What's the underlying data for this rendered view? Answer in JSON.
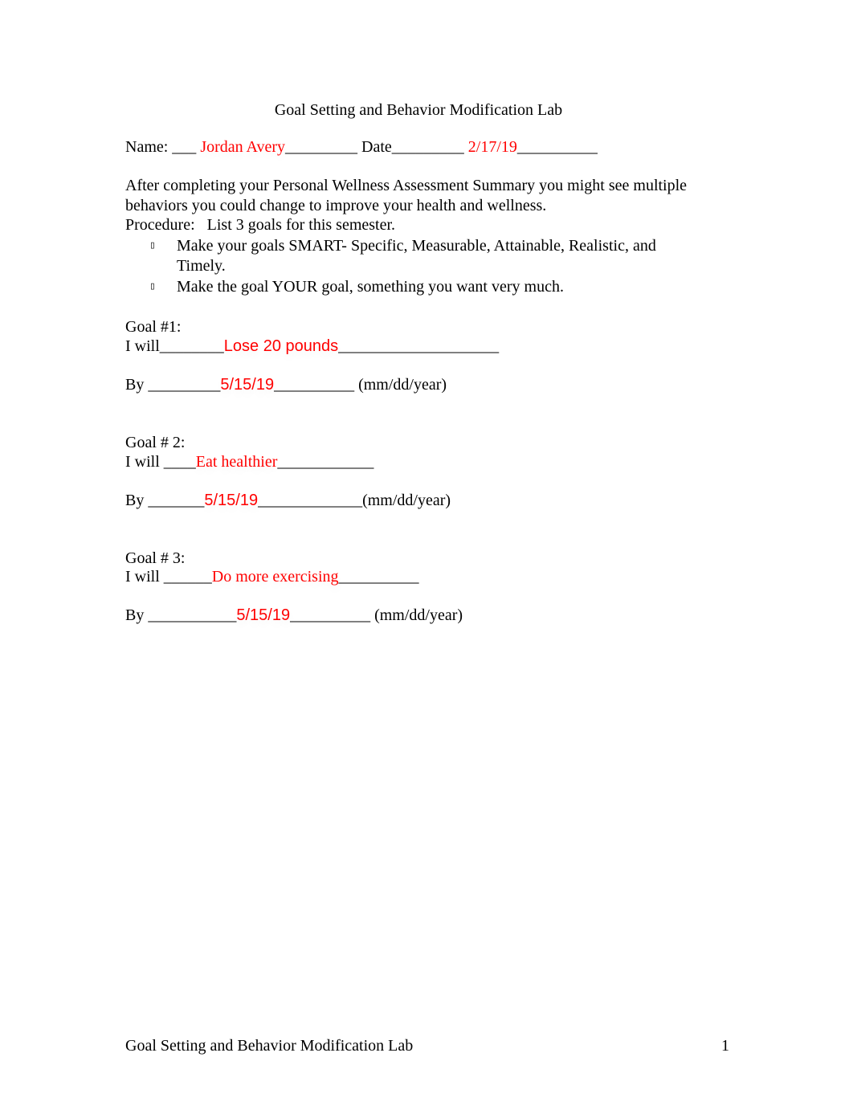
{
  "document": {
    "title": "Goal Setting and Behavior Modification Lab",
    "name_label": "Name: ___ ",
    "name_value": "Jordan Avery",
    "name_trail": "_________ Date_________ ",
    "date_value": "2/17/19",
    "date_trail": "__________",
    "intro_line1": "After completing your Personal Wellness Assessment Summary you might see multiple",
    "intro_line2": "behaviors you could change to improve your health and wellness.",
    "procedure": "Procedure:   List 3 goals for this semester.",
    "bullet_glyph": "▯",
    "bullets": [
      {
        "line1": "Make your goals SMART- Specific, Measurable, Attainable, Realistic, and",
        "line2": "Timely."
      },
      {
        "line1": "Make the goal YOUR goal, something you want very much.",
        "line2": ""
      }
    ],
    "goals": [
      {
        "heading": "Goal #1:",
        "will_prefix": "I will________",
        "will_value": "Lose 20 pounds",
        "will_suffix": "____________________",
        "by_prefix": "By _________",
        "by_value": "5/15/19",
        "by_suffix": "__________ (mm/dd/year)"
      },
      {
        "heading": "Goal # 2:",
        "will_prefix": "I will ____",
        "will_value": "Eat healthier",
        "will_suffix": "____________",
        "by_prefix": "By _______",
        "by_value": "5/15/19",
        "by_suffix": "_____________(mm/dd/year)"
      },
      {
        "heading": "Goal # 3:",
        "will_prefix": "I will ______",
        "will_value": "Do more exercising",
        "will_suffix": "__________",
        "by_prefix": "By ___________",
        "by_value": "5/15/19",
        "by_suffix": "__________ (mm/dd/year)"
      }
    ],
    "footer_text": "Goal Setting and Behavior Modification Lab",
    "page_number": "1"
  }
}
